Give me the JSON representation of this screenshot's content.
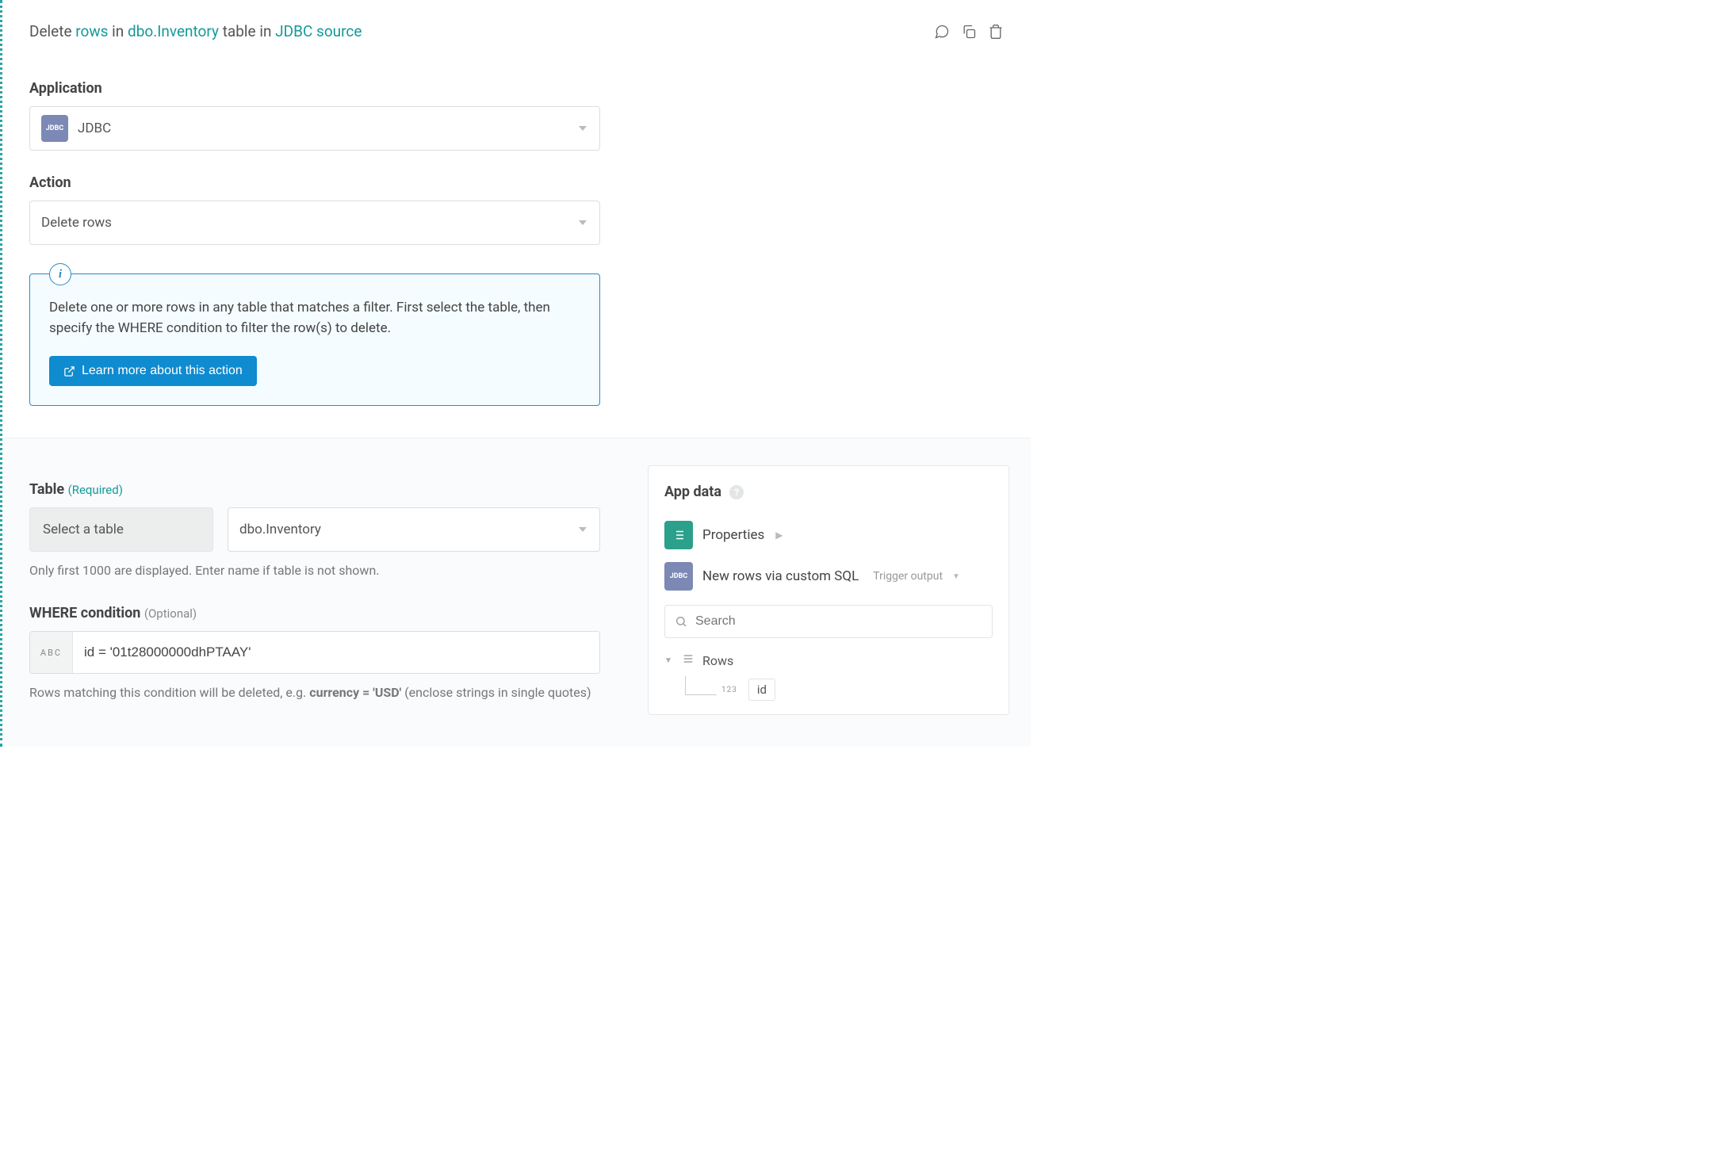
{
  "header": {
    "title_parts": {
      "p1": "Delete ",
      "a1": "rows",
      "p2": " in ",
      "a2": "dbo.Inventory",
      "p3": " table in ",
      "a3": "JDBC source"
    }
  },
  "application": {
    "label": "Application",
    "value": "JDBC",
    "badge": "JDBC"
  },
  "action": {
    "label": "Action",
    "value": "Delete rows"
  },
  "info": {
    "text": "Delete one or more rows in any table that matches a filter. First select the table, then specify the WHERE condition to filter the row(s) to delete.",
    "button": "Learn more about this action"
  },
  "table": {
    "label": "Table",
    "req": "(Required)",
    "mode": "Select a table",
    "value": "dbo.Inventory",
    "help": "Only first 1000 are displayed. Enter name if table is not shown."
  },
  "where": {
    "label": "WHERE condition",
    "opt": "(Optional)",
    "prefix": "ABC",
    "value": "id = '01t28000000dhPTAAY'",
    "help_pre": "Rows matching this condition will be deleted, e.g. ",
    "help_strong": "currency = 'USD'",
    "help_post": " (enclose strings in single quotes)"
  },
  "appdata": {
    "title": "App data",
    "properties_label": "Properties",
    "trigger_label": "New rows via custom SQL",
    "trigger_meta": "Trigger output",
    "jdbc_badge": "JDBC",
    "search_placeholder": "Search",
    "rows_label": "Rows",
    "id_label": "id",
    "id_prefix": "123"
  }
}
